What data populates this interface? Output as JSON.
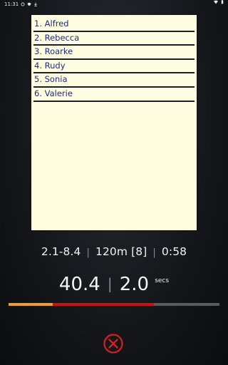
{
  "status_bar": {
    "time": "11:31"
  },
  "list": {
    "items": [
      "1. Alfred",
      "2. Rebecca",
      "3. Roarke",
      "4. Rudy",
      "5. Sonia",
      "6. Valerie"
    ]
  },
  "stats": {
    "range": "2.1-8.4",
    "distance": "120m [8]",
    "elapsed": "0:58",
    "separator": "|"
  },
  "timer": {
    "value": "40.4",
    "interval": "2.0",
    "unit": "secs",
    "separator": "|"
  },
  "progress": {
    "fill_fraction": 0.21,
    "secondary_fraction": 0.69,
    "fill_color": "#f0a020",
    "secondary_color": "#cc1111"
  },
  "controls": {
    "close_icon": "close-circle-icon",
    "close_color": "#d42020"
  }
}
